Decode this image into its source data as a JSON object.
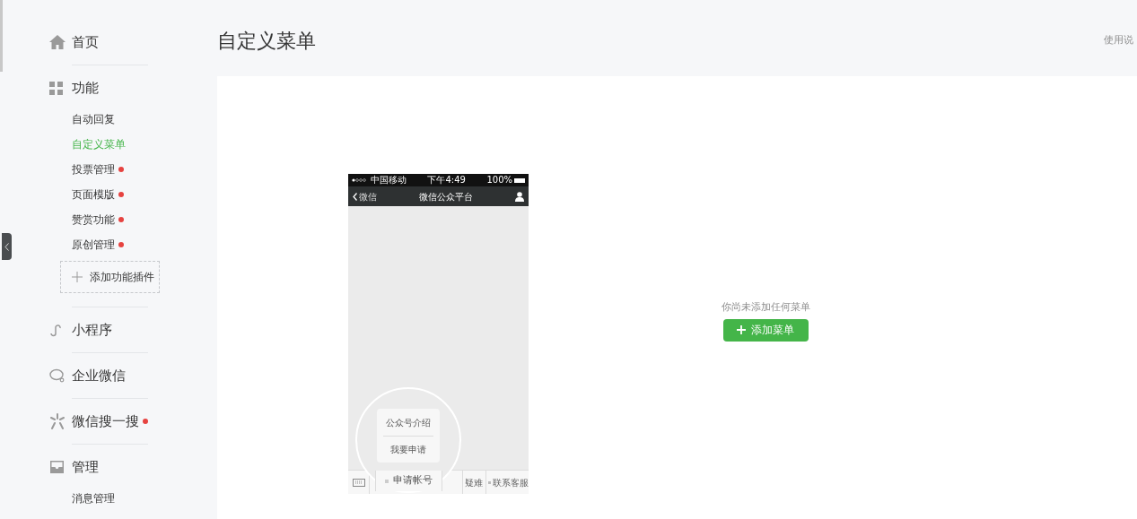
{
  "sidebar": {
    "sections": [
      {
        "label": "首页",
        "dot": false
      },
      {
        "label": "功能",
        "dot": false,
        "items": [
          {
            "label": "自动回复",
            "selected": false,
            "dot": false
          },
          {
            "label": "自定义菜单",
            "selected": true,
            "dot": false
          },
          {
            "label": "投票管理",
            "selected": false,
            "dot": true
          },
          {
            "label": "页面模版",
            "selected": false,
            "dot": true
          },
          {
            "label": "赞赏功能",
            "selected": false,
            "dot": true
          },
          {
            "label": "原创管理",
            "selected": false,
            "dot": true
          }
        ],
        "add_button": "添加功能插件"
      },
      {
        "label": "小程序",
        "dot": false
      },
      {
        "label": "企业微信",
        "dot": false
      },
      {
        "label": "微信搜一搜",
        "dot": true
      },
      {
        "label": "管理",
        "dot": false,
        "items": [
          {
            "label": "消息管理",
            "selected": false,
            "dot": false
          }
        ]
      }
    ]
  },
  "page": {
    "title": "自定义菜单",
    "help_link": "使用说"
  },
  "phone": {
    "carrier": "中国移动",
    "time": "下午4:49",
    "battery": "100%",
    "back": "微信",
    "title": "微信公众平台",
    "menu": [
      "疑难",
      "联系客服"
    ],
    "popup": [
      "公众号介绍",
      "我要申请"
    ],
    "magnified_menu": "申请帐号"
  },
  "empty_state": {
    "message": "你尚未添加任何菜单",
    "button": "添加菜单"
  }
}
